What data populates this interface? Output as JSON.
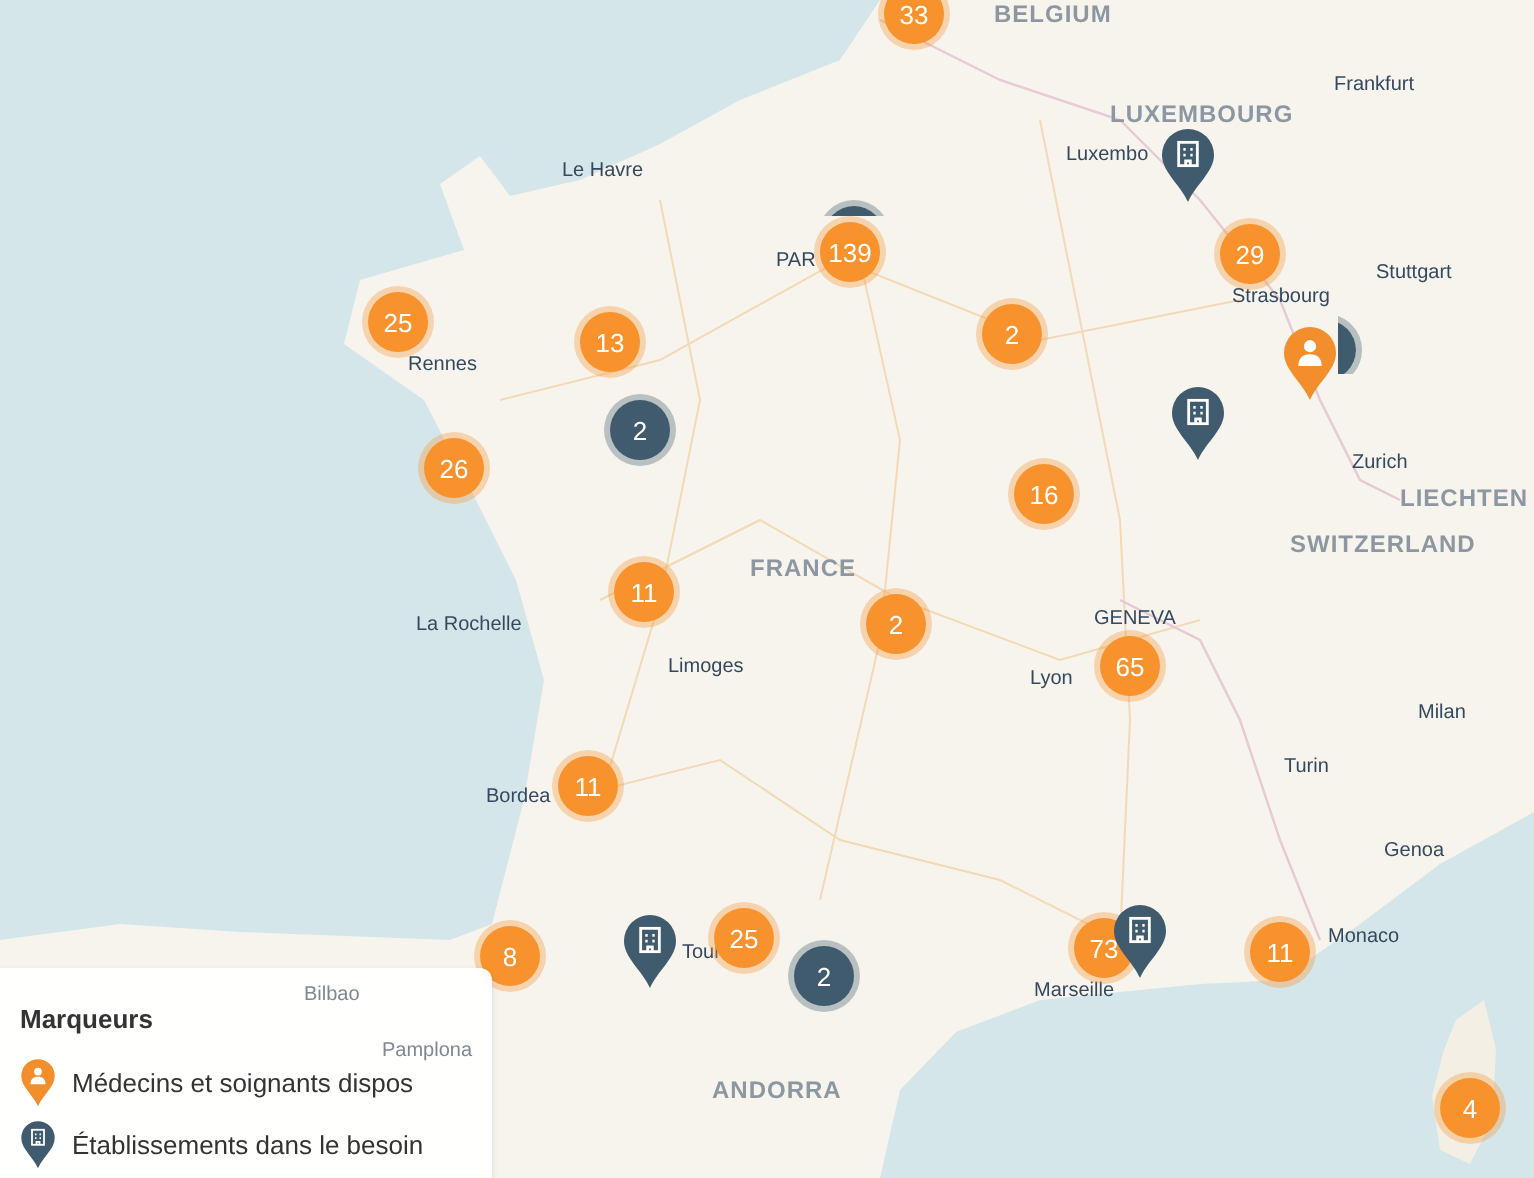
{
  "map": {
    "labels": [
      {
        "kind": "country",
        "text": "BELGIUM"
      },
      {
        "kind": "country",
        "text": "LUXEMBOURG"
      },
      {
        "kind": "city",
        "text": "Luxembo"
      },
      {
        "kind": "city",
        "text": "Frankfurt"
      },
      {
        "kind": "city",
        "text": "Le Havre"
      },
      {
        "kind": "city",
        "text": "PAR"
      },
      {
        "kind": "city",
        "text": "Stuttgart"
      },
      {
        "kind": "city",
        "text": "Strasbourg"
      },
      {
        "kind": "city",
        "text": "Rennes"
      },
      {
        "kind": "city",
        "text": "Zurich"
      },
      {
        "kind": "country",
        "text": "LIECHTEN"
      },
      {
        "kind": "country",
        "text": "SWITZERLAND"
      },
      {
        "kind": "country",
        "text": "FRANCE"
      },
      {
        "kind": "city",
        "text": "GENEVA"
      },
      {
        "kind": "city",
        "text": "La Rochelle"
      },
      {
        "kind": "city",
        "text": "Limoges"
      },
      {
        "kind": "city",
        "text": "Lyon"
      },
      {
        "kind": "city",
        "text": "Milan"
      },
      {
        "kind": "city",
        "text": "Turin"
      },
      {
        "kind": "city",
        "text": "Bordea"
      },
      {
        "kind": "city",
        "text": "Genoa"
      },
      {
        "kind": "city",
        "text": "Monaco"
      },
      {
        "kind": "underlay",
        "text": "Bilbao"
      },
      {
        "kind": "city",
        "text": "Toul"
      },
      {
        "kind": "city",
        "text": "Marseille"
      },
      {
        "kind": "underlay",
        "text": "Pamplona"
      },
      {
        "kind": "country",
        "text": "ANDORRA"
      }
    ],
    "markers": [
      {
        "kind": "cluster",
        "label": "33",
        "color": "#f7922d"
      },
      {
        "kind": "cluster",
        "color": "#3f5b6d"
      },
      {
        "kind": "cluster",
        "label": "139",
        "color": "#f7922d"
      },
      {
        "kind": "hospital"
      },
      {
        "kind": "cluster",
        "label": "25",
        "color": "#f7922d"
      },
      {
        "kind": "cluster",
        "label": "13",
        "color": "#f7922d"
      },
      {
        "kind": "cluster",
        "label": "2",
        "color": "#f7922d"
      },
      {
        "kind": "cluster",
        "label": "29",
        "color": "#f7922d"
      },
      {
        "kind": "cluster",
        "color": "#3f5b6d"
      },
      {
        "kind": "doctor"
      },
      {
        "kind": "cluster",
        "label": "2",
        "color": "#3f5b6d"
      },
      {
        "kind": "hospital"
      },
      {
        "kind": "cluster",
        "label": "26",
        "color": "#f7922d"
      },
      {
        "kind": "cluster",
        "label": "16",
        "color": "#f7922d"
      },
      {
        "kind": "cluster",
        "label": "11",
        "color": "#f7922d"
      },
      {
        "kind": "cluster",
        "label": "2",
        "color": "#f7922d"
      },
      {
        "kind": "cluster",
        "label": "65",
        "color": "#f7922d"
      },
      {
        "kind": "cluster",
        "label": "11",
        "color": "#f7922d"
      },
      {
        "kind": "cluster",
        "label": "8",
        "color": "#f7922d"
      },
      {
        "kind": "cluster",
        "label": "25",
        "color": "#f7922d"
      },
      {
        "kind": "hospital"
      },
      {
        "kind": "cluster",
        "label": "2",
        "color": "#3f5b6d"
      },
      {
        "kind": "cluster",
        "label": "73",
        "color": "#f7922d"
      },
      {
        "kind": "hospital"
      },
      {
        "kind": "cluster",
        "label": "11",
        "color": "#f7922d"
      },
      {
        "kind": "cluster",
        "label": "4",
        "color": "#f7922d"
      }
    ]
  },
  "legend": {
    "title": "Marqueurs",
    "items": [
      {
        "kind": "doctor",
        "label": "Médecins et soignants dispos"
      },
      {
        "kind": "hospital",
        "label": "Établissements dans le besoin"
      }
    ]
  }
}
